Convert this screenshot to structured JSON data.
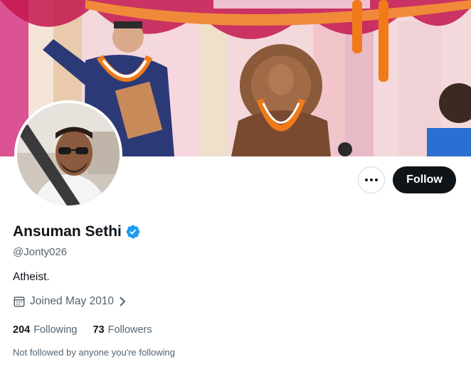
{
  "profile": {
    "display_name": "Ansuman Sethi",
    "handle": "@Jonty026",
    "bio": "Atheist.",
    "joined": "Joined May 2010",
    "verified": true
  },
  "actions": {
    "follow_label": "Follow",
    "more_icon": "more-horizontal-icon"
  },
  "stats": {
    "following_count": "204",
    "following_label": "Following",
    "followers_count": "73",
    "followers_label": "Followers"
  },
  "social_context": "Not followed by anyone you're following",
  "colors": {
    "verified_blue": "#1d9bf0",
    "follow_bg": "#0f1419",
    "secondary_text": "#536471"
  },
  "icons": {
    "calendar": "calendar-icon",
    "chevron": "chevron-right-icon",
    "verified": "verified-badge-icon"
  }
}
